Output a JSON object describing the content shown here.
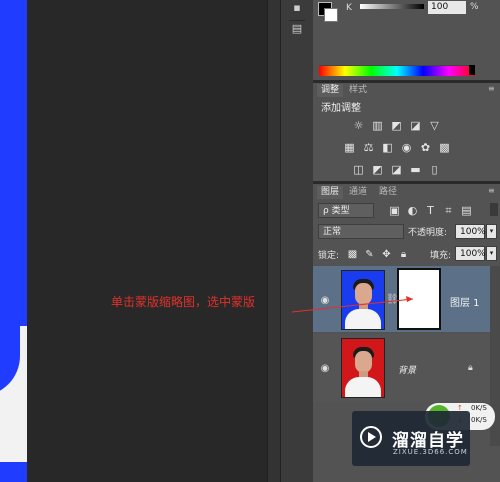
{
  "color_panel": {
    "channel_label": "K",
    "k_value": "100",
    "k_unit": "%"
  },
  "adjustments_panel": {
    "tabs": [
      "调整",
      "样式"
    ],
    "title": "添加调整"
  },
  "layers_panel": {
    "tabs": [
      "图层",
      "通道",
      "路径"
    ],
    "filter_label": "ρ 类型",
    "blend_mode": "正常",
    "opacity_label": "不透明度:",
    "opacity_value": "100%",
    "lock_label": "锁定:",
    "fill_label": "填充:",
    "fill_value": "100%",
    "layers": [
      {
        "name": "图层 1",
        "selected": true,
        "has_mask": true
      },
      {
        "name": "背景",
        "selected": false,
        "locked": true
      }
    ]
  },
  "annotation": {
    "text": "单击蒙版缩略图，选中蒙版",
    "color": "#e0312b"
  },
  "watermark": {
    "title": "溜溜自学",
    "subtitle": "ZIXUE.3D66.COM"
  },
  "network_badge": {
    "upload": "0K/S",
    "download": "0K/S"
  },
  "colors": {
    "canvas_blue": "#1f3cff",
    "panel_bg": "#535353",
    "selected_layer": "#5c7088",
    "photo_red_bg": "#d2171a",
    "photo_blue_bg": "#1a3cf0"
  }
}
